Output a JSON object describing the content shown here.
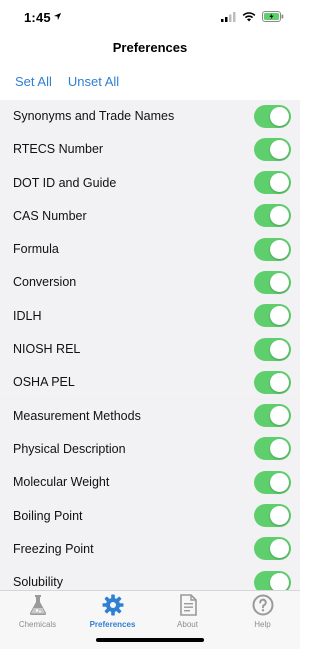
{
  "status_bar": {
    "time": "1:45"
  },
  "nav": {
    "title": "Preferences"
  },
  "actions": {
    "set_all": "Set All",
    "unset_all": "Unset All"
  },
  "preferences": [
    {
      "label": "Synonyms and Trade Names",
      "enabled": true
    },
    {
      "label": "RTECS Number",
      "enabled": true
    },
    {
      "label": "DOT ID and Guide",
      "enabled": true
    },
    {
      "label": "CAS Number",
      "enabled": true
    },
    {
      "label": "Formula",
      "enabled": true
    },
    {
      "label": "Conversion",
      "enabled": true
    },
    {
      "label": "IDLH",
      "enabled": true
    },
    {
      "label": "NIOSH REL",
      "enabled": true
    },
    {
      "label": "OSHA PEL",
      "enabled": true
    },
    {
      "label": "Measurement Methods",
      "enabled": true
    },
    {
      "label": "Physical Description",
      "enabled": true
    },
    {
      "label": "Molecular Weight",
      "enabled": true
    },
    {
      "label": "Boiling Point",
      "enabled": true
    },
    {
      "label": "Freezing Point",
      "enabled": true
    },
    {
      "label": "Solubility",
      "enabled": true
    }
  ],
  "tabs": [
    {
      "label": "Chemicals",
      "icon": "flask-icon",
      "active": false
    },
    {
      "label": "Preferences",
      "icon": "gear-icon",
      "active": true
    },
    {
      "label": "About",
      "icon": "document-icon",
      "active": false
    },
    {
      "label": "Help",
      "icon": "help-icon",
      "active": false
    }
  ],
  "colors": {
    "accent": "#2f7fd3",
    "toggle_on": "#5fcf6d",
    "battery": "#5fcf6d"
  }
}
